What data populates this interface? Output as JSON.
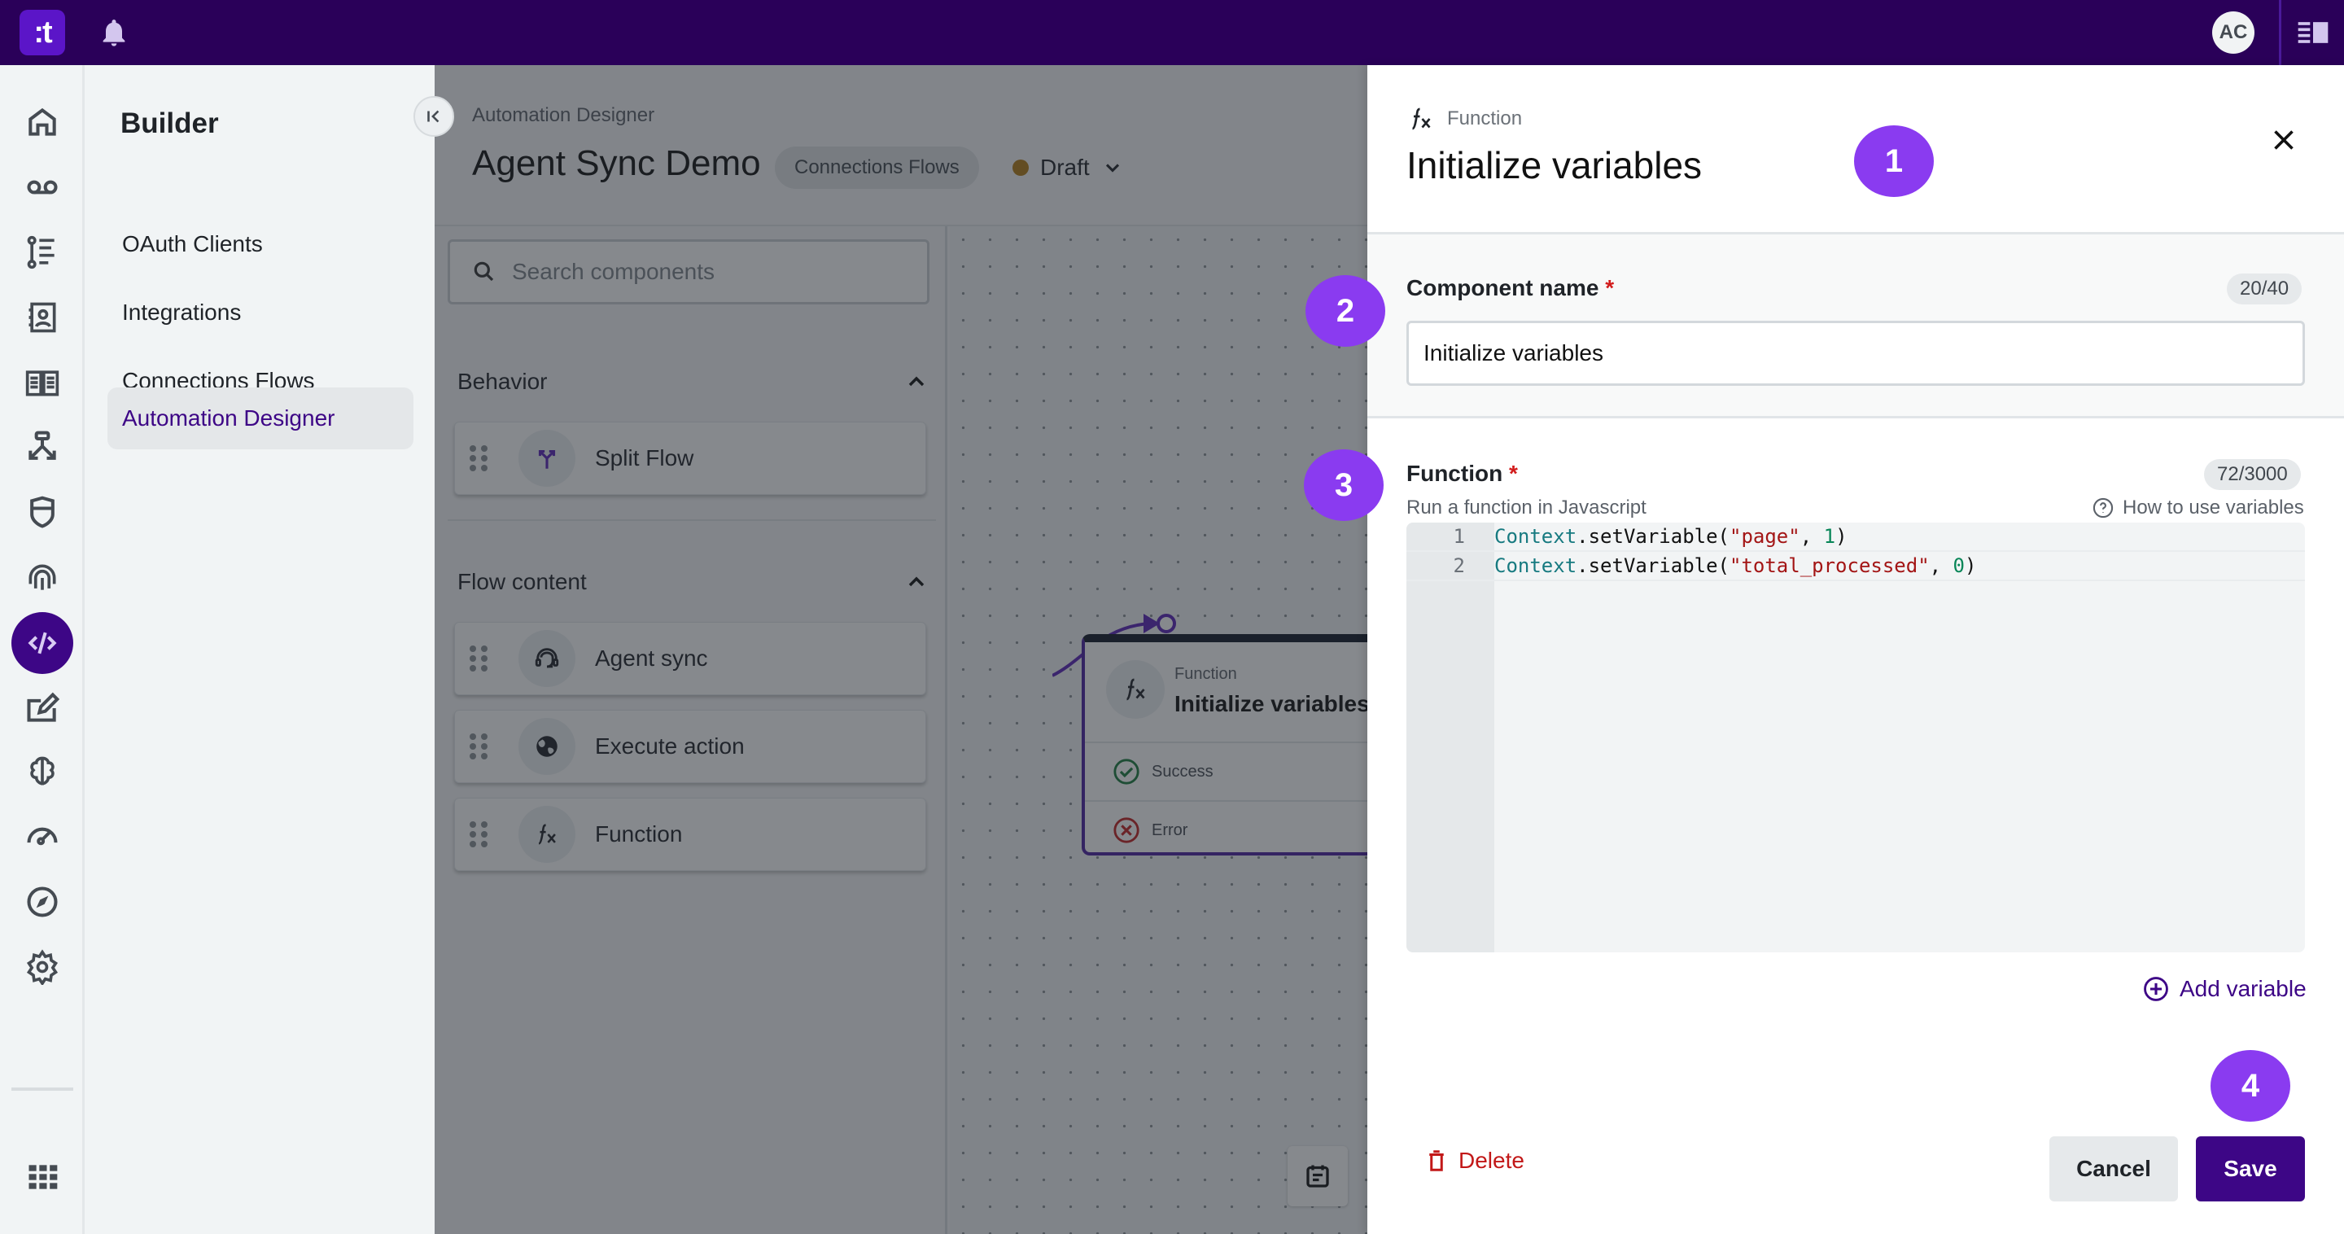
{
  "topbar": {
    "logo_text": ":t",
    "avatar_initials": "AC",
    "icons": [
      "bell-icon",
      "panel-toggle-icon"
    ]
  },
  "rail": {
    "icons": [
      "home-icon",
      "voicemail-icon",
      "flow-list-icon",
      "contacts-icon",
      "book-icon",
      "branch-icon",
      "shield-icon",
      "fingerprint-icon",
      "code-icon",
      "edit-icon",
      "brain-icon",
      "gauge-icon",
      "compass-icon",
      "gear-icon",
      "apps-grid-icon"
    ],
    "active": "code-icon"
  },
  "nav": {
    "title": "Builder",
    "items": [
      {
        "label": "OAuth Clients"
      },
      {
        "label": "Integrations"
      },
      {
        "label": "Connections Flows"
      },
      {
        "label": "Automation Designer",
        "active": true
      }
    ]
  },
  "header": {
    "breadcrumb": "Automation Designer",
    "title": "Agent Sync Demo",
    "pill": "Connections Flows",
    "status": "Draft",
    "status_color": "#b27a16"
  },
  "components": {
    "search_placeholder": "Search components",
    "sections": [
      {
        "title": "Behavior",
        "items": [
          {
            "label": "Split Flow",
            "icon": "split-icon"
          }
        ]
      },
      {
        "title": "Flow content",
        "items": [
          {
            "label": "Agent sync",
            "icon": "headset-agent-icon"
          },
          {
            "label": "Execute action",
            "icon": "globe-icon"
          },
          {
            "label": "Function",
            "icon": "function-icon"
          }
        ]
      }
    ]
  },
  "canvas": {
    "node": {
      "type": "Function",
      "title": "Initialize variables",
      "outputs": [
        {
          "label": "Success"
        },
        {
          "label": "Error"
        }
      ]
    }
  },
  "panel": {
    "type_label": "Function",
    "title": "Initialize variables",
    "component_name": {
      "label": "Component name",
      "required": "*",
      "counter": "20/40",
      "value": "Initialize variables"
    },
    "function": {
      "label": "Function",
      "required": "*",
      "counter": "72/3000",
      "hint": "Run a function in Javascript",
      "help_link": "How to use variables",
      "lines": [
        {
          "n": "1",
          "obj": "Context",
          "call": ".setVariable(",
          "str": "\"page\"",
          "sep": ", ",
          "num": "1",
          "end": ")"
        },
        {
          "n": "2",
          "obj": "Context",
          "call": ".setVariable(",
          "str": "\"total_processed\"",
          "sep": ", ",
          "num": "0",
          "end": ")"
        }
      ]
    },
    "add_variable": "Add variable",
    "delete": "Delete",
    "cancel": "Cancel",
    "save": "Save"
  },
  "badges": [
    "1",
    "2",
    "3",
    "4"
  ],
  "colors": {
    "brand_dark": "#2a0059",
    "accent": "#3d0686",
    "badge": "#8a3bf0",
    "danger": "#c21818"
  }
}
